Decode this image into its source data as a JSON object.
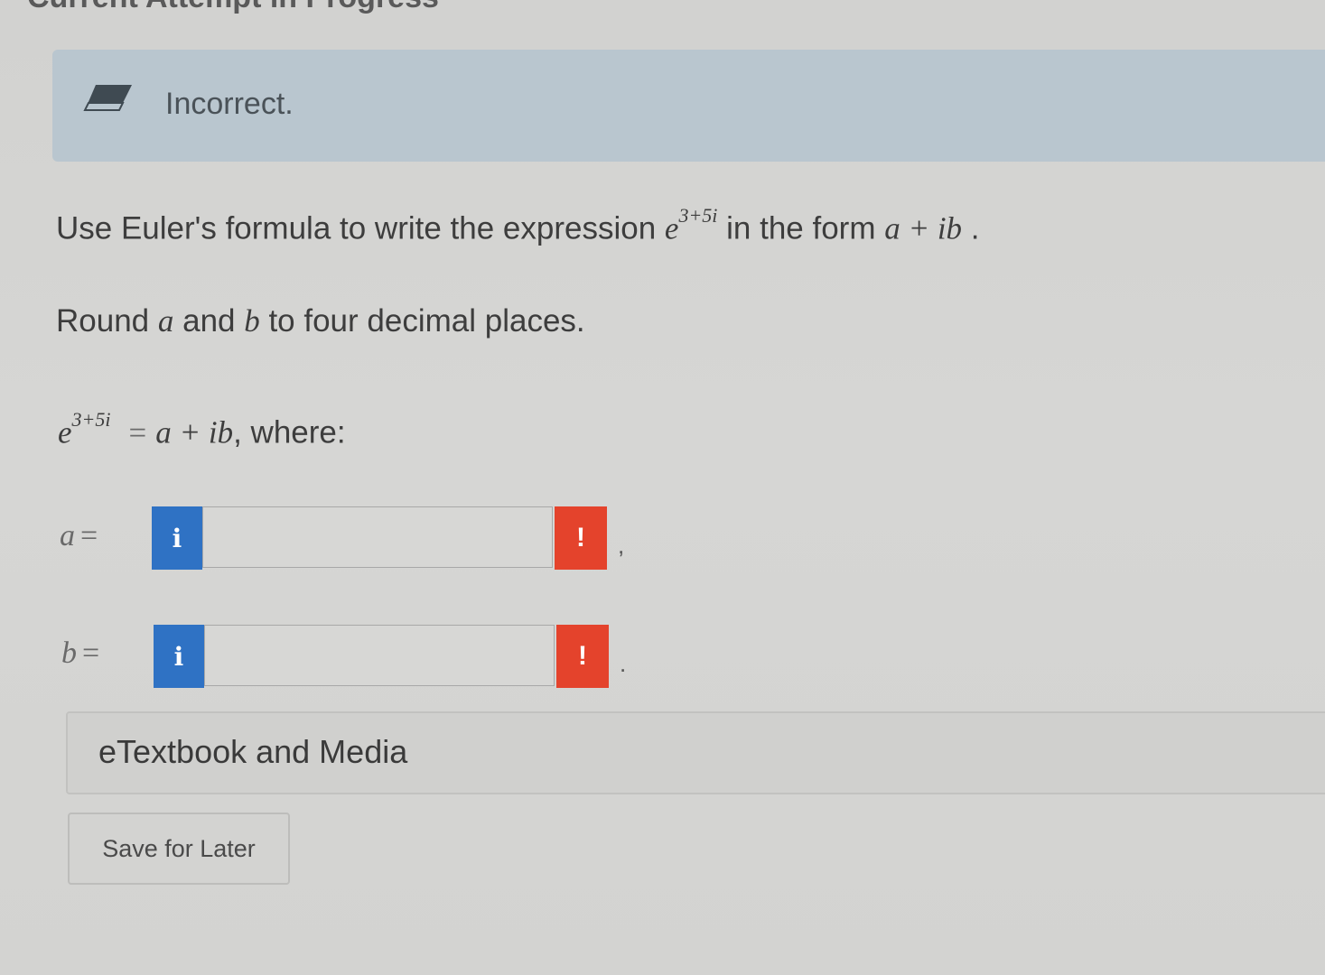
{
  "header": {
    "partial_title": "Current Attempt in Progress"
  },
  "feedback": {
    "icon": "eraser-icon",
    "text": "Incorrect."
  },
  "question": {
    "prefix": "Use Euler's formula to write the expression ",
    "base": "e",
    "exponent": "3+5i",
    "middle": " in the form ",
    "form": "a + ib",
    "suffix": " .",
    "instruction_prefix": "Round ",
    "var_a": "a",
    "instruction_and": " and ",
    "var_b": "b",
    "instruction_suffix": " to four decimal places.",
    "equation_base": "e",
    "equation_exponent": "3+5i",
    "equation_equals": "=",
    "equation_rhs": "a + ib",
    "equation_tail": ", where:"
  },
  "answers": [
    {
      "variable": "a",
      "equals": "=",
      "value": "",
      "info_label": "i",
      "alert_label": "!",
      "trailing": ","
    },
    {
      "variable": "b",
      "equals": "=",
      "value": "",
      "info_label": "i",
      "alert_label": "!",
      "trailing": "."
    }
  ],
  "etextbook": {
    "label": "eTextbook and Media"
  },
  "actions": {
    "save_label": "Save for Later"
  },
  "colors": {
    "banner": "#b9c6cf",
    "info": "#2f72c4",
    "alert": "#e4432c"
  }
}
